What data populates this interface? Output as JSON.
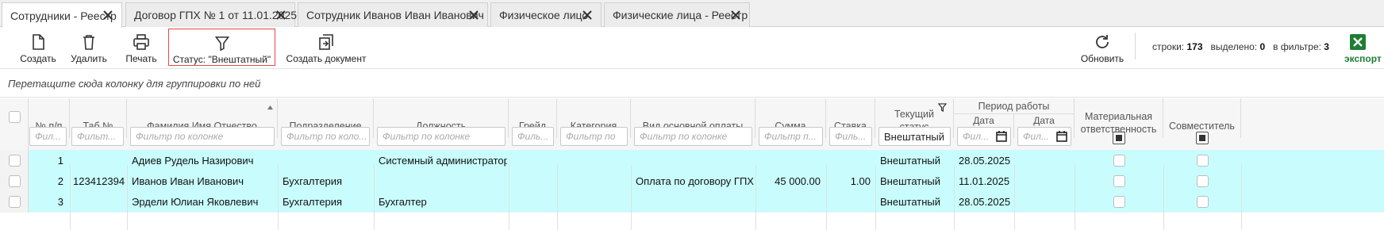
{
  "tabs": [
    {
      "label": "Сотрудники - Реестр",
      "active": true
    },
    {
      "label": "Договор ГПХ № 1 от 11.01.2025",
      "active": false
    },
    {
      "label": "Сотрудник Иванов Иван Иванович",
      "active": false
    },
    {
      "label": "Физическое лицо",
      "active": false
    },
    {
      "label": "Физические лица - Реестр",
      "active": false
    }
  ],
  "toolbar": {
    "create": "Создать",
    "delete": "Удалить",
    "print": "Печать",
    "status_filter": "Статус: \"Внештатный\"",
    "create_document": "Создать документ",
    "refresh": "Обновить",
    "export": "экспорт"
  },
  "counters": {
    "rows_label": "строки:",
    "rows_value": "173",
    "selected_label": "выделено:",
    "selected_value": "0",
    "filtered_label": "в фильтре:",
    "filtered_value": "3"
  },
  "group_hint": "Перетащите сюда колонку для группировки по ней",
  "columns": {
    "num": "№ п/п",
    "tab_num": "Таб.№",
    "fio": "Фамилия Имя Отчество",
    "department": "Подразделение",
    "position": "Должность",
    "grade": "Грейд",
    "category": "Категория",
    "pay_type": "Вид основной оплаты",
    "sum": "Сумма",
    "rate": "Ставка",
    "status": "Текущий статус",
    "period": "Период работы",
    "hire_date": "Дата приема",
    "fire_date": "Дата увольнения",
    "material": "Материальная ответственность",
    "combiner": "Совместитель"
  },
  "filters": {
    "num": "Фил...",
    "tab_num": "Фильт...",
    "fio": "Фильтр по колонке",
    "department": "Фильтр по коло...",
    "position": "Фильтр по колонке",
    "grade": "Филь...",
    "category": "Фильтр по",
    "pay_type": "Фильтр по колонке",
    "sum": "Фильтр п...",
    "rate": "Филь...",
    "status": "Внештатный",
    "hire_date": "Фил...",
    "fire_date": "Фил..."
  },
  "rows": [
    {
      "num": "1",
      "tab_num": "",
      "fio": "Адиев Рудель Назирович",
      "department": "",
      "position": "Системный администратор",
      "pay_type": "",
      "sum": "",
      "rate": "",
      "status": "Внештатный",
      "hire_date": "28.05.2025"
    },
    {
      "num": "2",
      "tab_num": "123412394",
      "fio": "Иванов Иван Иванович",
      "department": "Бухгалтерия",
      "position": "",
      "pay_type": "Оплата по договору ГПХ",
      "sum": "45 000.00",
      "rate": "1.00",
      "status": "Внештатный",
      "hire_date": "11.01.2025"
    },
    {
      "num": "3",
      "tab_num": "",
      "fio": "Эрдели Юлиан Яковлевич",
      "department": "Бухгалтерия",
      "position": "Бухгалтер",
      "pay_type": "",
      "sum": "",
      "rate": "",
      "status": "Внештатный",
      "hire_date": "28.05.2025"
    }
  ],
  "colors": {
    "row_highlight": "#c9fdfd",
    "filter_border": "#e0494f",
    "export_green": "#1e7e34"
  }
}
